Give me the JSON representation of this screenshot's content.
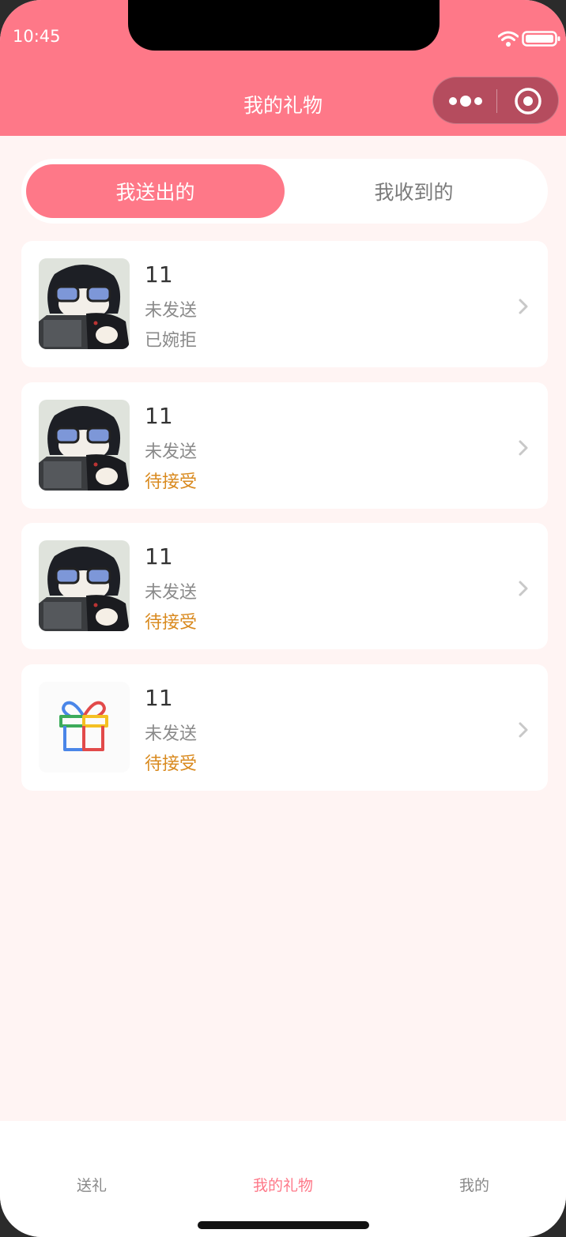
{
  "status_bar": {
    "time": "10:45"
  },
  "nav": {
    "title": "我的礼物"
  },
  "segment": {
    "tabs": [
      "我送出的",
      "我收到的"
    ],
    "active": 0
  },
  "gifts": [
    {
      "name": "11",
      "send_state": "未发送",
      "status": "已婉拒",
      "status_type": "declined",
      "thumb": "avatar-photo"
    },
    {
      "name": "11",
      "send_state": "未发送",
      "status": "待接受",
      "status_type": "pending",
      "thumb": "avatar-photo"
    },
    {
      "name": "11",
      "send_state": "未发送",
      "status": "待接受",
      "status_type": "pending",
      "thumb": "avatar-photo"
    },
    {
      "name": "11",
      "send_state": "未发送",
      "status": "待接受",
      "status_type": "pending",
      "thumb": "gift-icon"
    }
  ],
  "tabbar": {
    "items": [
      "送礼",
      "我的礼物",
      "我的"
    ],
    "active": 1
  },
  "colors": {
    "accent": "#fe7888",
    "pending": "#d98a1f",
    "page_bg": "#fff4f3"
  }
}
